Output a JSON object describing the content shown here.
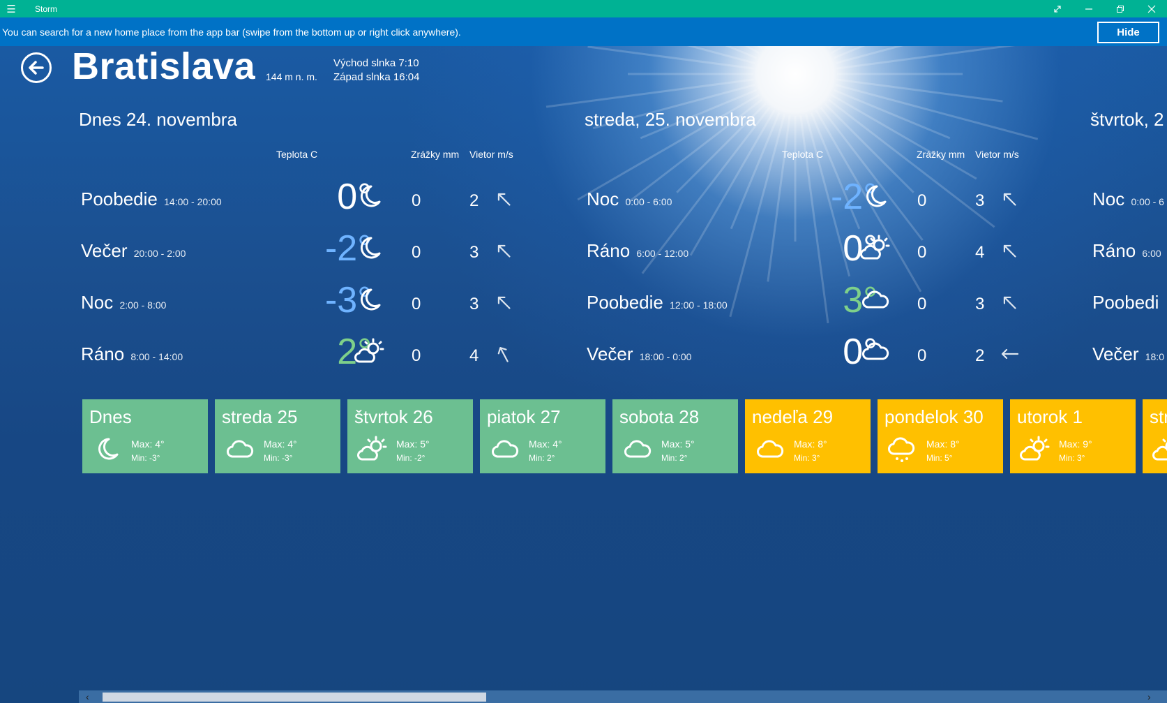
{
  "window": {
    "title": "Storm",
    "menu_icon": "hamburger-icon",
    "controls": [
      "expand-icon",
      "minimize-icon",
      "restore-icon",
      "close-icon"
    ]
  },
  "infobar": {
    "message": "You can search for a new home place from the app bar (swipe from the bottom up or right click anywhere).",
    "hide_label": "Hide"
  },
  "header": {
    "city": "Bratislava",
    "altitude": "144 m n. m.",
    "sunrise": "Východ slnka 7:10",
    "sunset": "Západ slnka 16:04"
  },
  "colors": {
    "temp_blue": "#6fb3ff",
    "temp_white": "#ffffff",
    "temp_green": "#7ed08a",
    "tile_green": "#6cbf91",
    "tile_yellow": "#ffc000"
  },
  "days": [
    {
      "title": "Dnes 24. novembra",
      "headers": {
        "temp": "Teplota C",
        "rain": "Zrážky mm",
        "wind": "Vietor  m/s"
      },
      "periods": [
        {
          "name": "Poobedie",
          "time": "14:00 - 20:00",
          "temp": "0°",
          "temp_color": "white",
          "icon": "moon-icon",
          "rain": "0",
          "wind": "2",
          "wind_dir": "nw"
        },
        {
          "name": "Večer",
          "time": "20:00 - 2:00",
          "temp": "-2°",
          "temp_color": "blue",
          "icon": "moon-icon",
          "rain": "0",
          "wind": "3",
          "wind_dir": "nw"
        },
        {
          "name": "Noc",
          "time": "2:00 - 8:00",
          "temp": "-3°",
          "temp_color": "blue",
          "icon": "moon-icon",
          "rain": "0",
          "wind": "3",
          "wind_dir": "nw"
        },
        {
          "name": "Ráno",
          "time": "8:00 - 14:00",
          "temp": "2°",
          "temp_color": "green",
          "icon": "partly-cloudy-icon",
          "rain": "0",
          "wind": "4",
          "wind_dir": "nnw"
        }
      ]
    },
    {
      "title": "streda, 25. novembra",
      "headers": {
        "temp": "Teplota C",
        "rain": "Zrážky mm",
        "wind": "Vietor  m/s"
      },
      "periods": [
        {
          "name": "Noc",
          "time": "0:00 - 6:00",
          "temp": "-2°",
          "temp_color": "blue",
          "icon": "moon-icon",
          "rain": "0",
          "wind": "3",
          "wind_dir": "nw"
        },
        {
          "name": "Ráno",
          "time": "6:00 - 12:00",
          "temp": "0°",
          "temp_color": "white",
          "icon": "partly-cloudy-icon",
          "rain": "0",
          "wind": "4",
          "wind_dir": "nw"
        },
        {
          "name": "Poobedie",
          "time": "12:00 - 18:00",
          "temp": "3°",
          "temp_color": "green",
          "icon": "cloud-icon",
          "rain": "0",
          "wind": "3",
          "wind_dir": "nw"
        },
        {
          "name": "Večer",
          "time": "18:00 - 0:00",
          "temp": "0°",
          "temp_color": "white",
          "icon": "cloud-icon",
          "rain": "0",
          "wind": "2",
          "wind_dir": "w"
        }
      ]
    },
    {
      "title": "štvrtok, 2",
      "headers": {
        "temp": "",
        "rain": "",
        "wind": ""
      },
      "periods": [
        {
          "name": "Noc",
          "time": "0:00 - 6",
          "temp": "",
          "temp_color": "white",
          "icon": "",
          "rain": "",
          "wind": "",
          "wind_dir": ""
        },
        {
          "name": "Ráno",
          "time": "6:00",
          "temp": "",
          "temp_color": "white",
          "icon": "",
          "rain": "",
          "wind": "",
          "wind_dir": ""
        },
        {
          "name": "Poobedi",
          "time": "",
          "temp": "",
          "temp_color": "white",
          "icon": "",
          "rain": "",
          "wind": "",
          "wind_dir": ""
        },
        {
          "name": "Večer",
          "time": "18:0",
          "temp": "",
          "temp_color": "white",
          "icon": "",
          "rain": "",
          "wind": "",
          "wind_dir": ""
        }
      ]
    }
  ],
  "forecast_tiles": [
    {
      "name": "Dnes",
      "icon": "moon-icon",
      "max": "Max: 4°",
      "min": "Min: -3°",
      "color": "green"
    },
    {
      "name": "streda 25",
      "icon": "cloud-icon",
      "max": "Max: 4°",
      "min": "Min: -3°",
      "color": "green"
    },
    {
      "name": "štvrtok 26",
      "icon": "partly-cloudy-icon",
      "max": "Max: 5°",
      "min": "Min: -2°",
      "color": "green"
    },
    {
      "name": "piatok 27",
      "icon": "cloud-icon",
      "max": "Max: 4°",
      "min": "Min: 2°",
      "color": "green"
    },
    {
      "name": "sobota 28",
      "icon": "cloud-icon",
      "max": "Max: 5°",
      "min": "Min: 2°",
      "color": "green"
    },
    {
      "name": "nedeľa 29",
      "icon": "cloud-icon",
      "max": "Max: 8°",
      "min": "Min: 3°",
      "color": "yellow"
    },
    {
      "name": "pondelok 30",
      "icon": "rain-cloud-icon",
      "max": "Max: 8°",
      "min": "Min: 5°",
      "color": "yellow"
    },
    {
      "name": "utorok 1",
      "icon": "partly-cloudy-icon",
      "max": "Max: 9°",
      "min": "Min: 3°",
      "color": "yellow"
    },
    {
      "name": "str",
      "icon": "partly-cloudy-icon",
      "max": "",
      "min": "",
      "color": "yellow"
    }
  ],
  "scrollbar": {
    "left_arrow": "‹",
    "right_arrow": "›"
  }
}
